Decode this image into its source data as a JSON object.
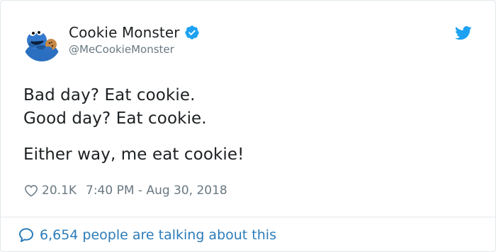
{
  "user": {
    "display_name": "Cookie Monster",
    "handle": "@MeCookieMonster",
    "verified": true,
    "avatar_icon": "cookie-monster-avatar"
  },
  "brand": {
    "icon": "twitter-bird-icon",
    "color": "#1da1f2"
  },
  "tweet": {
    "lines": [
      "Bad day? Eat cookie.",
      "Good day? Eat cookie.",
      "Either way, me eat cookie!"
    ]
  },
  "meta": {
    "like_icon": "heart-icon",
    "likes": "20.1K",
    "timestamp": "7:40 PM - Aug 30, 2018"
  },
  "footer": {
    "icon": "speech-bubble-icon",
    "text": "6,654 people are talking about this",
    "color": "#2b7bb9"
  },
  "colors": {
    "text": "#1c2022",
    "muted": "#697882",
    "border": "#e1e8ed",
    "verified": "#1da1f2"
  }
}
